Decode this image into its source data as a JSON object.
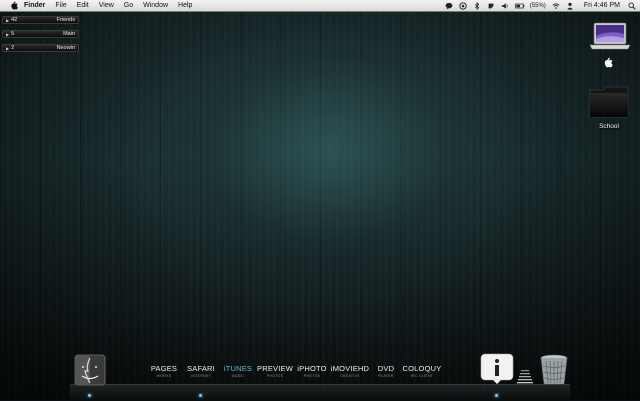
{
  "menubar": {
    "app_name": "Finder",
    "items": [
      "File",
      "Edit",
      "View",
      "Go",
      "Window",
      "Help"
    ],
    "battery": "(55%)",
    "clock": "Fri 4:46 PM"
  },
  "widgets": [
    {
      "count": "42",
      "label": "Friends"
    },
    {
      "count": "5",
      "label": "Main"
    },
    {
      "count": "2",
      "label": "Neowin"
    }
  ],
  "desktop": {
    "school_label": "School"
  },
  "dock": {
    "apps": [
      {
        "name": "PAGES",
        "sub": "WORKS"
      },
      {
        "name": "SAFARI",
        "sub": "INTERNET"
      },
      {
        "name": "iTUNES",
        "sub": "MUSIC",
        "active": true
      },
      {
        "name": "PREVIEW",
        "sub": "PHOTOS"
      },
      {
        "name": "iPHOTO",
        "sub": "PHOTOS"
      },
      {
        "name": "iMOVIEHD",
        "sub": "CREATIVE"
      },
      {
        "name": "DVD",
        "sub": "PLAYER"
      },
      {
        "name": "COLOQUY",
        "sub": "IRC CLIENT"
      }
    ]
  },
  "colors": {
    "active_accent": "#6fb4d8",
    "running_dot": "#7cc7ff"
  }
}
